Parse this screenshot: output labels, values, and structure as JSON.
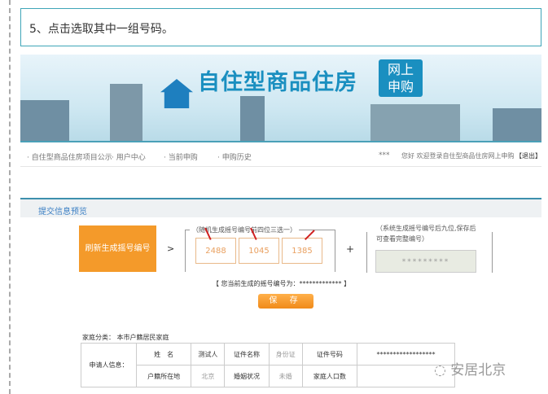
{
  "caption": "5、点击选取其中一组号码。",
  "banner": {
    "title": "自住型商品住房",
    "tag_line1": "网上",
    "tag_line2": "申购"
  },
  "nav": {
    "items": [
      "· 自住型商品住房项目公示",
      "· 用户中心",
      "· 当前申购",
      "· 申购历史"
    ],
    "user": "***",
    "welcome": "您好 欢迎登录自住型商品住房网上申购",
    "logout": "【退出】"
  },
  "section_title": "提交信息预览",
  "generate_button": "刷新生成摇号编号",
  "gt": ">",
  "group_label": "（随机生成摇号编号前四位三选一）",
  "numbers": [
    "2488",
    "1045",
    "1385"
  ],
  "plus": "+",
  "system_label": "（系统生成摇号编号后九位,保存后可查看完整编号）",
  "system_stars": "*********",
  "current": "【 您当前生成的摇号编号为：************* 】",
  "save_button": "保 存",
  "family_type": "家庭分类： 本市户籍居民家庭",
  "table": {
    "applicant": "申请人信息：",
    "rows": [
      [
        "姓　名",
        "测试人",
        "证件名称",
        "身份证",
        "证件号码",
        "******************"
      ],
      [
        "户籍所在地",
        "北京",
        "婚姻状况",
        "未婚",
        "家庭人口数",
        ""
      ]
    ]
  },
  "watermark": "安居北京"
}
